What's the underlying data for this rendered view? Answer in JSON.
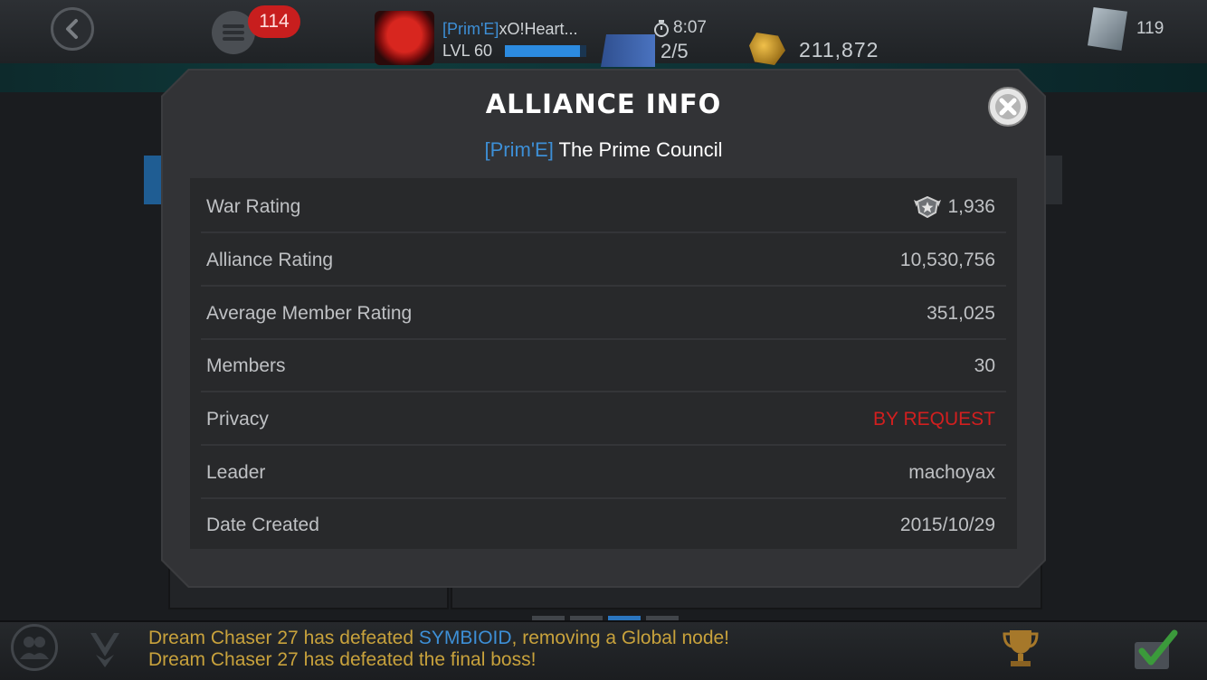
{
  "header": {
    "chat_count": "114",
    "player": {
      "alliance_tag": "[Prim'E]",
      "name": "xO!Heart...",
      "level": "LVL 60",
      "xp_fraction": 0.92
    },
    "energy_timer": "8:07",
    "energy": "2/5",
    "gold": "211,872",
    "units": "119"
  },
  "modal": {
    "title": "ALLIANCE INFO",
    "alliance_tag": "[Prim'E]",
    "alliance_name": "The Prime Council",
    "rows": [
      {
        "label": "War Rating",
        "value": "1,936"
      },
      {
        "label": "Alliance Rating",
        "value": "10,530,756"
      },
      {
        "label": "Average Member Rating",
        "value": "351,025"
      },
      {
        "label": "Members",
        "value": "30"
      },
      {
        "label": "Privacy",
        "value": "BY REQUEST"
      },
      {
        "label": "Leader",
        "value": "machoyax"
      },
      {
        "label": "Date Created",
        "value": "2015/10/29"
      }
    ]
  },
  "ticker": {
    "line1": {
      "prefix": "Dream Chaser 27 has defeated ",
      "highlight": "SYMBIOID",
      "suffix": ", removing a Global node!"
    },
    "line2": "Dream Chaser 27 has defeated the final boss!"
  },
  "colors": {
    "accent_blue": "#3d8fd6",
    "privacy_red": "#d21f1f",
    "ticker_gold": "#c8a23c",
    "badge_red": "#c81e1e"
  },
  "icons": [
    "back-arrow-icon",
    "chat-icon",
    "hero-portrait-icon",
    "energy-icon",
    "timer-icon",
    "gold-icon",
    "units-icon",
    "close-icon",
    "war-rating-icon",
    "friends-icon",
    "alliance-icon",
    "trophy-icon",
    "checkmark-icon"
  ]
}
